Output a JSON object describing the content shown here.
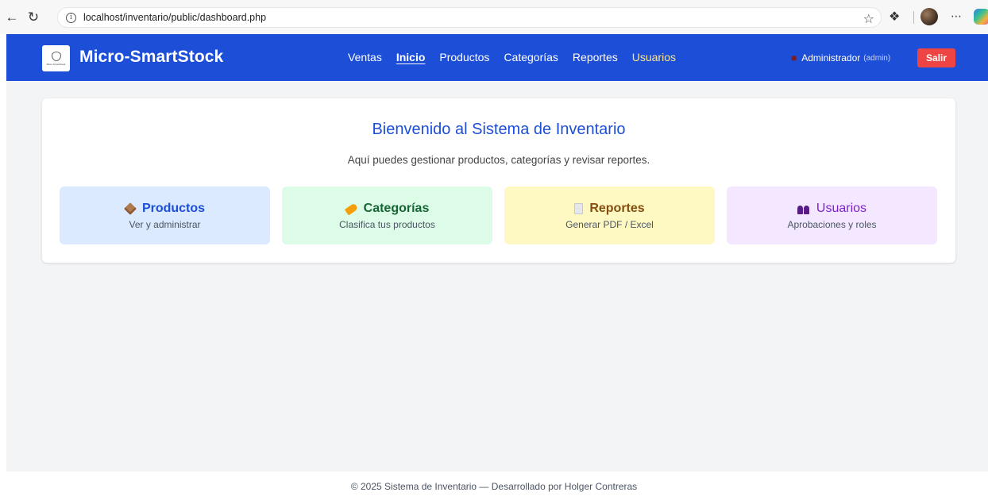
{
  "browser": {
    "url": "localhost/inventario/public/dashboard.php",
    "icons": [
      "back-icon",
      "reload-icon",
      "info-icon",
      "star-icon",
      "extensions-icon",
      "profile-avatar",
      "more-icon",
      "copilot-icon"
    ]
  },
  "navbar": {
    "brand": "Micro-SmartStock",
    "logo_caption": "Micro-SmartStock",
    "links": [
      {
        "label": "Ventas"
      },
      {
        "label": "Inicio"
      },
      {
        "label": "Productos"
      },
      {
        "label": "Categorías"
      },
      {
        "label": "Reportes"
      },
      {
        "label": "Usuarios"
      }
    ],
    "user_name": "Administrador",
    "user_role": "(admin)",
    "logout": "Salir",
    "colors": {
      "bar": "#1d4ed8",
      "logout": "#ef4444",
      "highlight": "#fde68a"
    }
  },
  "main": {
    "title": "Bienvenido al Sistema de Inventario",
    "subtitle": "Aquí puedes gestionar productos, categorías y revisar reportes.",
    "tiles": [
      {
        "icon": "package-icon",
        "title": "Productos",
        "description": "Ver y administrar",
        "color": "#dbeafe"
      },
      {
        "icon": "tag-icon",
        "title": "Categorías",
        "description": "Clasifica tus productos",
        "color": "#dcfce7"
      },
      {
        "icon": "document-icon",
        "title": "Reportes",
        "description": "Generar PDF / Excel",
        "color": "#fef9c3"
      },
      {
        "icon": "users-icon",
        "title": "Usuarios",
        "description": "Aprobaciones y roles",
        "color": "#f3e8ff"
      }
    ]
  },
  "footer": {
    "text": "© 2025 Sistema de Inventario — Desarrollado por Holger Contreras"
  }
}
